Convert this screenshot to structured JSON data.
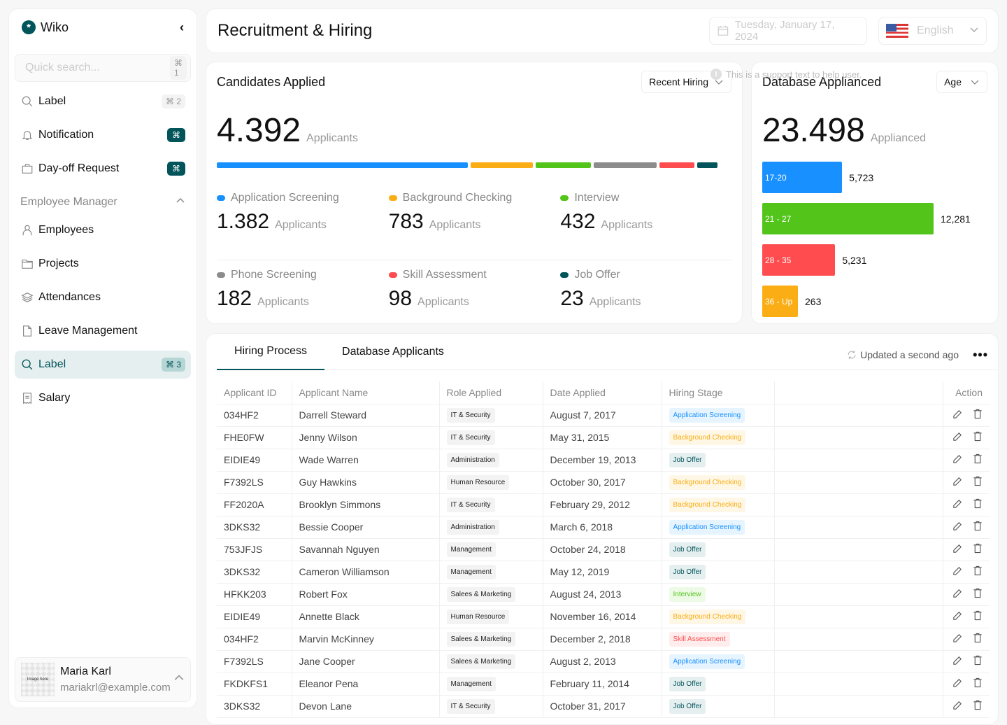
{
  "sidebar": {
    "brand": "Wiko",
    "search": {
      "placeholder": "Quick search...",
      "shortcut": "⌘ 1"
    },
    "items": [
      {
        "label": "Label",
        "shortcut": "⌘ 2",
        "icon": "search-icon"
      },
      {
        "label": "Notification",
        "shortcut": "⌘",
        "icon": "bell-icon"
      },
      {
        "label": "Day-off Request",
        "shortcut": "⌘",
        "icon": "bag-icon"
      }
    ],
    "section": "Employee Manager",
    "section_items": [
      {
        "label": "Employees",
        "icon": "user-icon"
      },
      {
        "label": "Projects",
        "icon": "folder-icon"
      },
      {
        "label": "Attendances",
        "icon": "layers-icon"
      },
      {
        "label": "Leave Management",
        "icon": "file-icon"
      },
      {
        "label": "Label",
        "shortcut": "⌘ 3",
        "icon": "search-icon",
        "active": true
      },
      {
        "label": "Salary",
        "icon": "receipt-icon"
      }
    ],
    "user": {
      "name": "Maria Karl",
      "email": "mariakrl@example.com",
      "avatar_text": "Image here"
    }
  },
  "header": {
    "title": "Recruitment & Hiring",
    "date": "Tuesday, January 17, 2024",
    "language": "English"
  },
  "tooltip": "This is a support text to help user.",
  "candidates": {
    "title": "Candidates Applied",
    "filter": "Recent Hiring",
    "total": "4.392",
    "unit": "Applicants",
    "stages": [
      {
        "label": "Application Screening",
        "value": "1.382",
        "color": "#1890ff",
        "share": 0.5
      },
      {
        "label": "Background Checking",
        "value": "783",
        "color": "#faad14",
        "share": 0.125
      },
      {
        "label": "Interview",
        "value": "432",
        "color": "#52c41a",
        "share": 0.11
      },
      {
        "label": "Phone Screening",
        "value": "182",
        "color": "#8c8c8c",
        "share": 0.125
      },
      {
        "label": "Skill Assessment",
        "value": "98",
        "color": "#ff4d4f",
        "share": 0.07
      },
      {
        "label": "Job Offer",
        "value": "23",
        "color": "#00545a",
        "share": 0.04
      }
    ]
  },
  "database": {
    "title": "Database Applianced",
    "filter": "Age",
    "total": "23.498",
    "unit": "Applianced",
    "max": 12281,
    "groups": [
      {
        "label": "17-20",
        "value": 5723,
        "display": "5,723",
        "color": "#1890ff"
      },
      {
        "label": "21 - 27",
        "value": 12281,
        "display": "12,281",
        "color": "#52c41a"
      },
      {
        "label": "28 - 35",
        "value": 5231,
        "display": "5,231",
        "color": "#ff4d4f"
      },
      {
        "label": "36 - Up",
        "value": 263,
        "display": "263",
        "color": "#faad14"
      }
    ]
  },
  "table": {
    "tabs": [
      "Hiring Process",
      "Database Applicants"
    ],
    "updated": "Updated a second ago",
    "columns": [
      "Applicant ID",
      "Applicant Name",
      "Role Applied",
      "Date Applied",
      "Hiring Stage",
      "",
      "Action"
    ],
    "stage_styles": {
      "Application Screening": {
        "bg": "#e6f4ff",
        "fg": "#1890ff"
      },
      "Background Checking": {
        "bg": "#fff7e6",
        "fg": "#faad14"
      },
      "Job Offer": {
        "bg": "#e6eff0",
        "fg": "#00545a"
      },
      "Interview": {
        "bg": "#edfbe6",
        "fg": "#52c41a"
      },
      "Skill Assessment": {
        "bg": "#ffecec",
        "fg": "#ff4d4f"
      }
    },
    "rows": [
      {
        "id": "034HF2",
        "name": "Darrell Steward",
        "role": "IT & Security",
        "date": "August 7, 2017",
        "stage": "Application Screening"
      },
      {
        "id": "FHE0FW",
        "name": "Jenny Wilson",
        "role": "IT & Security",
        "date": "May 31, 2015",
        "stage": "Background Checking"
      },
      {
        "id": "EIDIE49",
        "name": "Wade Warren",
        "role": "Administration",
        "date": "December 19, 2013",
        "stage": "Job Offer"
      },
      {
        "id": "F7392LS",
        "name": "Guy Hawkins",
        "role": "Human Resource",
        "date": "October 30, 2017",
        "stage": "Background Checking"
      },
      {
        "id": "FF2020A",
        "name": "Brooklyn Simmons",
        "role": "IT & Security",
        "date": "February 29, 2012",
        "stage": "Background Checking"
      },
      {
        "id": "3DKS32",
        "name": "Bessie Cooper",
        "role": "Administration",
        "date": "March 6, 2018",
        "stage": "Application Screening"
      },
      {
        "id": "753JFJS",
        "name": "Savannah Nguyen",
        "role": "Management",
        "date": "October 24, 2018",
        "stage": "Job Offer"
      },
      {
        "id": "3DKS32",
        "name": "Cameron Williamson",
        "role": "Management",
        "date": "May 12, 2019",
        "stage": "Job Offer"
      },
      {
        "id": "HFKK203",
        "name": "Robert Fox",
        "role": "Salees & Marketing",
        "date": "August 24, 2013",
        "stage": "Interview"
      },
      {
        "id": "EIDIE49",
        "name": "Annette Black",
        "role": "Human Resource",
        "date": "November 16, 2014",
        "stage": "Background Checking"
      },
      {
        "id": "034HF2",
        "name": "Marvin McKinney",
        "role": "Salees & Marketing",
        "date": "December 2, 2018",
        "stage": "Skill Assessment"
      },
      {
        "id": "F7392LS",
        "name": "Jane Cooper",
        "role": "Salees & Marketing",
        "date": "August 2, 2013",
        "stage": "Application Screening"
      },
      {
        "id": "FKDKFS1",
        "name": "Eleanor Pena",
        "role": "Management",
        "date": "February 11, 2014",
        "stage": "Job Offer"
      },
      {
        "id": "3DKS32",
        "name": "Devon Lane",
        "role": "IT & Security",
        "date": "October 31, 2017",
        "stage": "Job Offer"
      }
    ]
  }
}
